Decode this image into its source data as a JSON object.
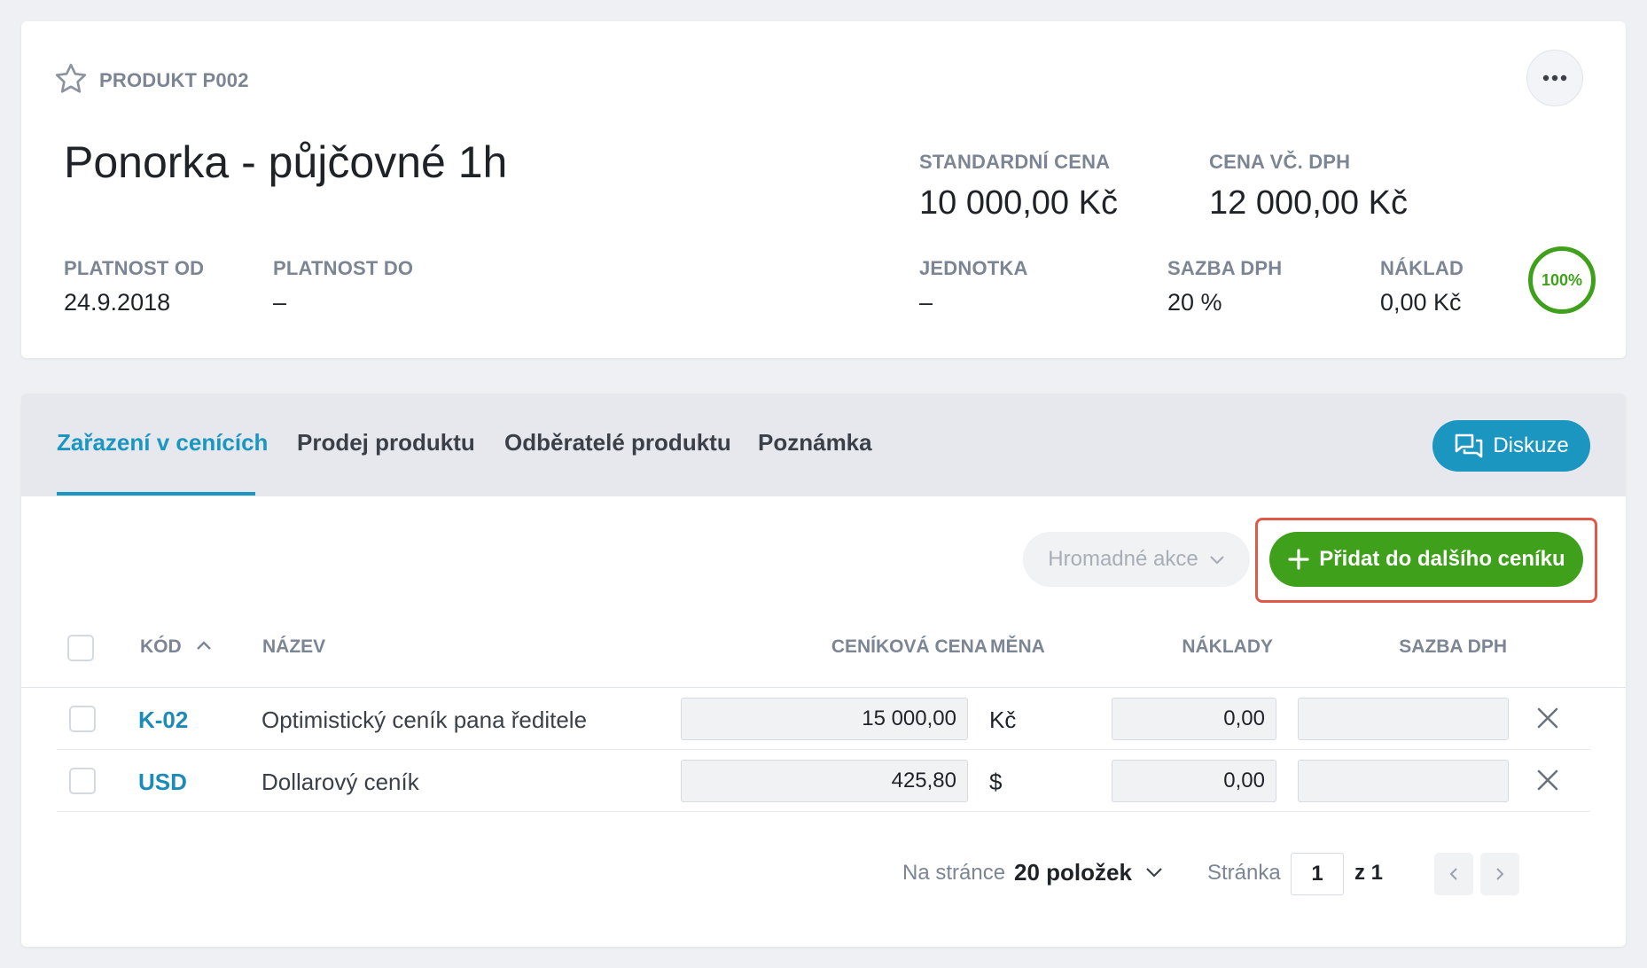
{
  "header": {
    "product_code": "PRODUKT P002",
    "title": "Ponorka - půjčovné 1h",
    "standard_price_label": "STANDARDNÍ CENA",
    "standard_price_value": "10 000,00 Kč",
    "price_vat_label": "CENA VČ. DPH",
    "price_vat_value": "12 000,00 Kč",
    "valid_from_label": "PLATNOST OD",
    "valid_from_value": "24.9.2018",
    "valid_to_label": "PLATNOST DO",
    "valid_to_value": "–",
    "unit_label": "JEDNOTKA",
    "unit_value": "–",
    "vat_rate_label": "SAZBA DPH",
    "vat_rate_value": "20 %",
    "cost_label": "NÁKLAD",
    "cost_value": "0,00 Kč",
    "completeness": "100%"
  },
  "tabs": [
    {
      "label": "Zařazení v cenících",
      "active": true
    },
    {
      "label": "Prodej produktu",
      "active": false
    },
    {
      "label": "Odběratelé produktu",
      "active": false
    },
    {
      "label": "Poznámka",
      "active": false
    }
  ],
  "discuss_label": "Diskuze",
  "actions": {
    "bulk_label": "Hromadné akce",
    "add_label": "Přidat do dalšího ceníku"
  },
  "table": {
    "columns": {
      "code": "KÓD",
      "name": "NÁZEV",
      "price": "CENÍKOVÁ CENA",
      "currency": "MĚNA",
      "costs": "NÁKLADY",
      "vat": "SAZBA DPH"
    },
    "rows": [
      {
        "code": "K-02",
        "name": "Optimistický ceník pana ředitele",
        "price": "15 000,00",
        "currency": "Kč",
        "costs": "0,00",
        "vat": ""
      },
      {
        "code": "USD",
        "name": "Dollarový ceník",
        "price": "425,80",
        "currency": "$",
        "costs": "0,00",
        "vat": ""
      }
    ]
  },
  "pagination": {
    "per_page_label": "Na stránce",
    "per_page_value": "20 položek",
    "page_label": "Stránka",
    "page_current": "1",
    "page_of": "z 1"
  },
  "colors": {
    "accent": "#1b96c0",
    "success": "#3fa11b",
    "highlight": "#e0584a"
  }
}
